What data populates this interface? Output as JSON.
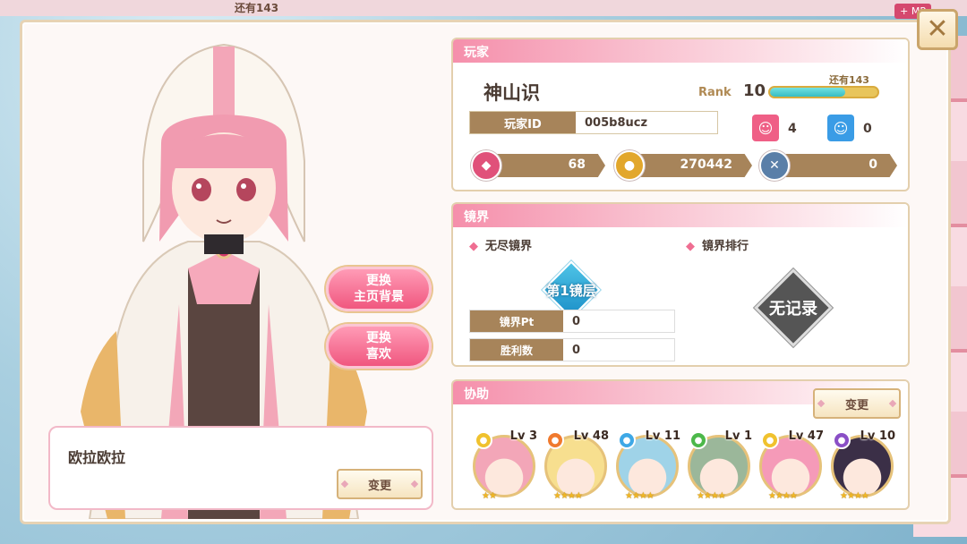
{
  "top_bar": {
    "remain_text": "还有143",
    "mp_tag": "+ MP"
  },
  "close_icon": "close-icon",
  "side_buttons": [
    {
      "line1": "更换",
      "line2": "主页背景"
    },
    {
      "line1": "更换",
      "line2": "喜欢"
    }
  ],
  "message": {
    "text": "欧拉欧拉",
    "change_label": "变更"
  },
  "player": {
    "header": "玩家",
    "name": "神山识",
    "rank_label": "Rank",
    "rank_value": "10",
    "rank_remain": "还有143",
    "rank_progress": 0.7,
    "id_label": "玩家ID",
    "id_value": "005b8ucz",
    "likes_count": "4",
    "follow_count": "0",
    "currencies": [
      {
        "icon": "gem-icon",
        "value": "68",
        "color": "#e0517a"
      },
      {
        "icon": "coin-icon",
        "value": "270442",
        "color": "#e2a72c"
      },
      {
        "icon": "sword-icon",
        "value": "0",
        "color": "#5a7fa8"
      }
    ]
  },
  "mirror": {
    "header": "镜界",
    "endless_title": "无尽镜界",
    "layer_badge": "第1镜层",
    "pt_label": "镜界Pt",
    "pt_value": "0",
    "wins_label": "胜利数",
    "wins_value": "0",
    "ranking_title": "镜界排行",
    "no_record": "无记录"
  },
  "support": {
    "header": "协助",
    "change_label": "变更",
    "members": [
      {
        "level": "Lv 3",
        "attr": "light",
        "attr_color": "#f0c22e",
        "hair": "#f3a6b8",
        "stars": "★★"
      },
      {
        "level": "Lv 48",
        "attr": "fire",
        "attr_color": "#f07a2e",
        "hair": "#f7df8f",
        "stars": "★★★★"
      },
      {
        "level": "Lv 11",
        "attr": "water",
        "attr_color": "#3ea8e6",
        "hair": "#9fd3e8",
        "stars": "★★★★"
      },
      {
        "level": "Lv 1",
        "attr": "forest",
        "attr_color": "#4cb84a",
        "hair": "#9bb79a",
        "stars": "★★★★"
      },
      {
        "level": "Lv 47",
        "attr": "light",
        "attr_color": "#f0c22e",
        "hair": "#f59ab8",
        "stars": "★★★★"
      },
      {
        "level": "Lv 10",
        "attr": "dark",
        "attr_color": "#8a4fc6",
        "hair": "#3b2f47",
        "stars": "★★★★"
      }
    ]
  }
}
